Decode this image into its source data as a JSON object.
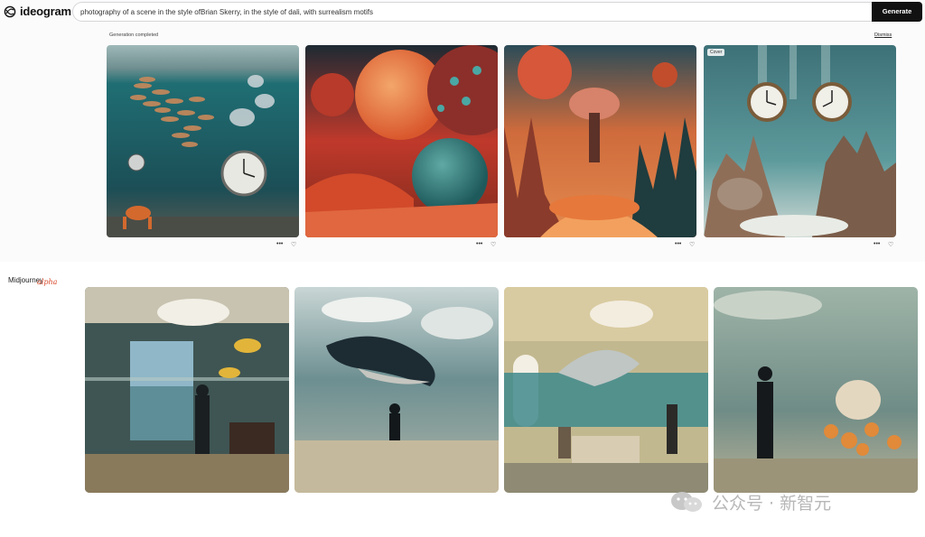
{
  "header": {
    "logo_text": "ideogram",
    "prompt": "photography of a scene in the style ofBrian Skerry, in the style of dali, with surrealism motifs",
    "generate_label": "Generate"
  },
  "results": {
    "status": "Generation completed",
    "dismiss_label": "Dismiss",
    "cover_badge": "Cover",
    "more_glyph": "•••",
    "like_glyph": "♡"
  },
  "midjourney": {
    "name": "Midjourney",
    "tag": "alpha"
  },
  "watermark": {
    "text": "公众号 · 新智元"
  },
  "colors": {
    "generate_bg": "#111111",
    "accent_alpha": "#d9482b"
  }
}
